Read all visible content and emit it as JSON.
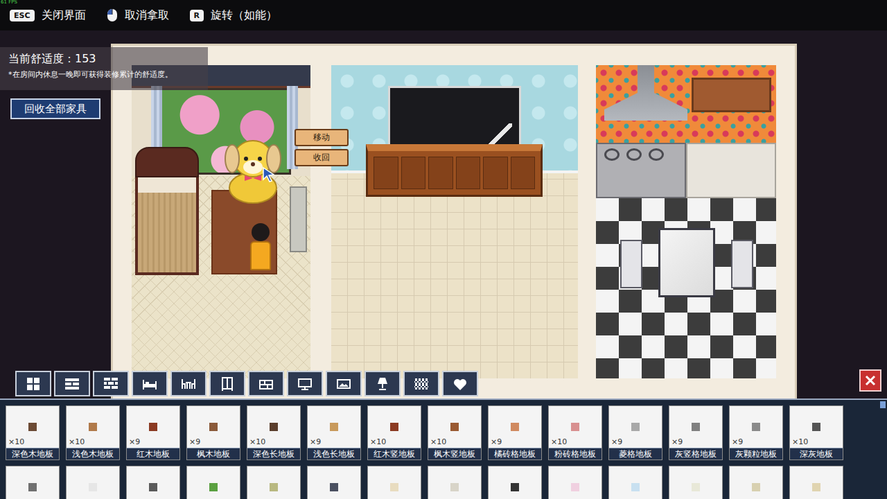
{
  "fps": "61 FPS",
  "hints": [
    {
      "kind": "key",
      "key": "ESC",
      "label": "关闭界面"
    },
    {
      "kind": "mouse",
      "key": "",
      "label": "取消拿取"
    },
    {
      "kind": "key",
      "key": "R",
      "label": "旋转（如能）"
    }
  ],
  "comfort": {
    "label": "当前舒适度：",
    "value": "153",
    "note": "*在房间内休息一晚即可获得装修累计的舒适度。"
  },
  "recycle_button": "回收全部家具",
  "context_menu": [
    "移动",
    "收回"
  ],
  "category_tabs": [
    {
      "selected": false
    },
    {
      "selected": false
    },
    {
      "selected": false
    },
    {
      "selected": false
    },
    {
      "selected": false
    },
    {
      "selected": false
    },
    {
      "selected": false
    },
    {
      "selected": false
    },
    {
      "selected": false
    },
    {
      "selected": false
    },
    {
      "selected": false
    },
    {
      "selected": false
    }
  ],
  "items": [
    {
      "name": "深色木地板",
      "count": "×10",
      "color": "#6b4a34"
    },
    {
      "name": "浅色木地板",
      "count": "×10",
      "color": "#b07a4a"
    },
    {
      "name": "红木地板",
      "count": "×9",
      "color": "#8b3a22"
    },
    {
      "name": "枫木地板",
      "count": "×9",
      "color": "#8b5a3a"
    },
    {
      "name": "深色长地板",
      "count": "×10",
      "color": "#5a3e2c"
    },
    {
      "name": "浅色长地板",
      "count": "×9",
      "color": "#c89a5c"
    },
    {
      "name": "红木竖地板",
      "count": "×10",
      "color": "#8b3a22"
    },
    {
      "name": "枫木竖地板",
      "count": "×10",
      "color": "#9a5a32"
    },
    {
      "name": "橘砖格地板",
      "count": "×9",
      "color": "#d08a60"
    },
    {
      "name": "粉砖格地板",
      "count": "×10",
      "color": "#d89090"
    },
    {
      "name": "菱格地板",
      "count": "×9",
      "color": "#a8a8a8"
    },
    {
      "name": "灰竖格地板",
      "count": "×9",
      "color": "#808080"
    },
    {
      "name": "灰颗粒地板",
      "count": "×9",
      "color": "#8a8a8a"
    },
    {
      "name": "深灰地板",
      "count": "×10",
      "color": "#555555"
    }
  ],
  "items_row2": [
    {
      "color": "#707070"
    },
    {
      "color": "#e6e6e6"
    },
    {
      "color": "#5a5a5a"
    },
    {
      "color": "#5aa040"
    },
    {
      "color": "#b8b880"
    },
    {
      "color": "#4a5060"
    },
    {
      "color": "#e8dcc0"
    },
    {
      "color": "#d8d4c8"
    },
    {
      "color": "#333333"
    },
    {
      "color": "#f0d0e0"
    },
    {
      "color": "#c8e0f0"
    },
    {
      "color": "#e8e8d8"
    },
    {
      "color": "#d8d0b0"
    },
    {
      "color": "#e0d4b0"
    }
  ]
}
